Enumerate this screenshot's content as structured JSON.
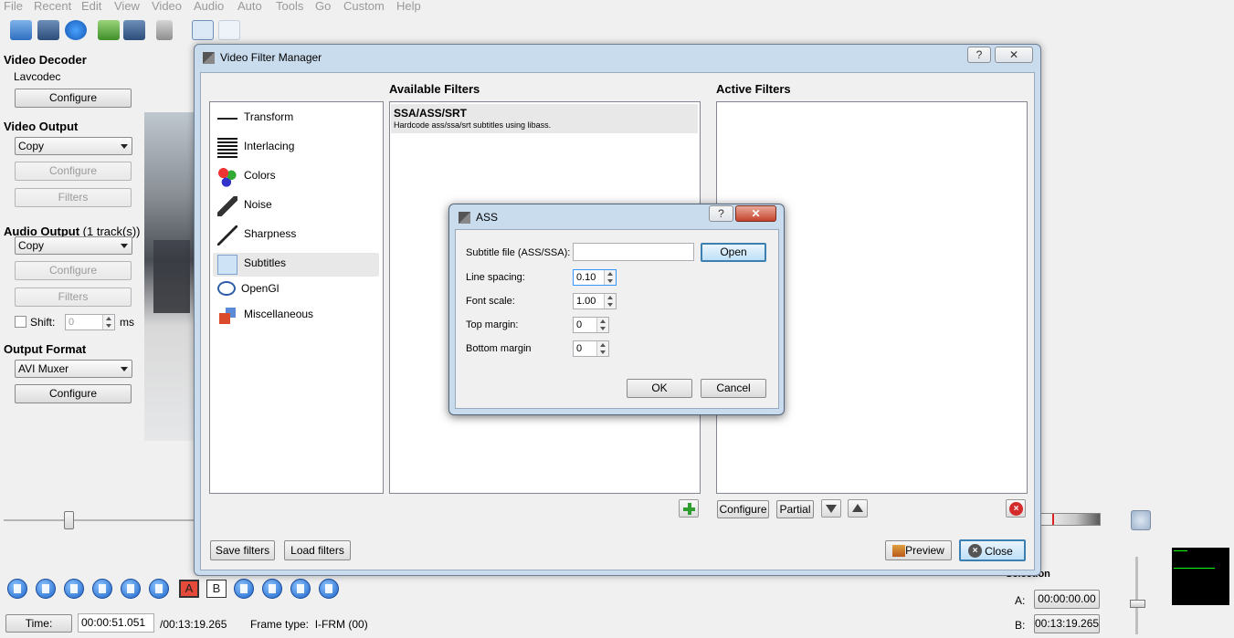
{
  "menu": [
    "File",
    "Recent",
    "Edit",
    "View",
    "Video",
    "Audio",
    "Auto",
    "Tools",
    "Go",
    "Custom",
    "Help"
  ],
  "left": {
    "video_decoder": {
      "title": "Video Decoder",
      "codec": "Lavcodec",
      "configure": "Configure"
    },
    "video_output": {
      "title": "Video Output",
      "selected": "Copy",
      "configure": "Configure",
      "filters": "Filters"
    },
    "audio_output": {
      "title": "Audio Output",
      "tracks": "(1 track(s))",
      "selected": "Copy",
      "configure": "Configure",
      "filters": "Filters",
      "shift_label": "Shift:",
      "shift_value": "0",
      "shift_unit": "ms"
    },
    "output_format": {
      "title": "Output Format",
      "selected": "AVI Muxer",
      "configure": "Configure"
    }
  },
  "bottom": {
    "time_button": "Time:",
    "current_time": "00:00:51.051",
    "total_time": "/00:13:19.265",
    "frame_type": "Frame type:  I-FRM (00)",
    "selection": "Selection",
    "a_label": "A:",
    "a_value": "00:00:00.00",
    "b_label": "B:",
    "b_value": "00:13:19.265",
    "marker_a": "A",
    "marker_b": "B"
  },
  "vfm": {
    "title": "Video Filter Manager",
    "help": "?",
    "close_x": "✕",
    "available_title": "Available Filters",
    "active_title": "Active Filters",
    "categories": [
      {
        "name": "transform-icon",
        "label": "Transform"
      },
      {
        "name": "interlacing-icon",
        "label": "Interlacing"
      },
      {
        "name": "colors-icon",
        "label": "Colors"
      },
      {
        "name": "noise-icon",
        "label": "Noise"
      },
      {
        "name": "sharpness-icon",
        "label": "Sharpness"
      },
      {
        "name": "subtitles-icon",
        "label": "Subtitles"
      },
      {
        "name": "opengl-icon",
        "label": "OpenGl"
      },
      {
        "name": "misc-icon",
        "label": "Miscellaneous"
      }
    ],
    "selected_category": "Subtitles",
    "filter_name": "SSA/ASS/SRT",
    "filter_desc": "Hardcode ass/ssa/srt subtitles using libass.",
    "configure": "Configure",
    "partial": "Partial",
    "save_filters": "Save filters",
    "load_filters": "Load filters",
    "preview": "Preview",
    "close": "Close"
  },
  "ass": {
    "title": "ASS",
    "help": "?",
    "close_x": "✕",
    "subtitle_label": "Subtitle file (ASS/SSA):",
    "subtitle_value": "",
    "open": "Open",
    "line_spacing_label": "Line spacing:",
    "line_spacing": "0.10",
    "font_scale_label": "Font scale:",
    "font_scale": "1.00",
    "top_margin_label": "Top margin:",
    "top_margin": "0",
    "bottom_margin_label": "Bottom margin",
    "bottom_margin": "0",
    "ok": "OK",
    "cancel": "Cancel"
  },
  "colors": {
    "accent": "#3399ff",
    "dialog_frame": "#c9dcee",
    "selected_row": "#e8e8e8"
  }
}
